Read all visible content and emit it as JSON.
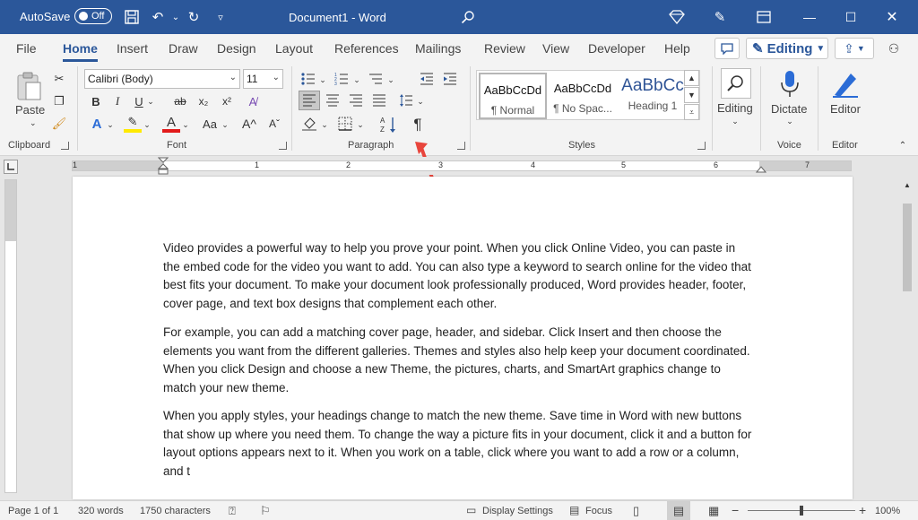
{
  "titlebar": {
    "autosave_label": "AutoSave",
    "autosave_state": "Off",
    "doc_title": "Document1  -  Word"
  },
  "tabs": [
    {
      "label": "File"
    },
    {
      "label": "Home"
    },
    {
      "label": "Insert"
    },
    {
      "label": "Draw"
    },
    {
      "label": "Design"
    },
    {
      "label": "Layout"
    },
    {
      "label": "References"
    },
    {
      "label": "Mailings"
    },
    {
      "label": "Review"
    },
    {
      "label": "View"
    },
    {
      "label": "Developer"
    },
    {
      "label": "Help"
    }
  ],
  "tabrow": {
    "editing_mode": "Editing"
  },
  "ribbon": {
    "clipboard": {
      "paste_label": "Paste",
      "group_label": "Clipboard"
    },
    "font": {
      "font_name": "Calibri (Body)",
      "font_size": "11",
      "group_label": "Font"
    },
    "paragraph": {
      "group_label": "Paragraph"
    },
    "styles": {
      "group_label": "Styles",
      "tiles": [
        {
          "preview": "AaBbCcDd",
          "name": "¶ Normal"
        },
        {
          "preview": "AaBbCcDd",
          "name": "¶ No Spac..."
        },
        {
          "preview": "AaBbCc",
          "name": "Heading 1"
        }
      ]
    },
    "editing": {
      "label": "Editing"
    },
    "voice": {
      "label": "Dictate",
      "group_label": "Voice"
    },
    "editor": {
      "label": "Editor",
      "group_label": "Editor"
    }
  },
  "ruler": {
    "numbers": [
      "1",
      "1",
      "2",
      "3",
      "4",
      "5",
      "6",
      "7"
    ]
  },
  "document": {
    "paragraphs": [
      "Video provides a powerful way to help you prove your point. When you click Online Video, you can paste in the embed code for the video you want to add. You can also type a keyword to search online for the video that best fits your document. To make your document look professionally produced, Word provides header, footer, cover page, and text box designs that complement each other.",
      "For example, you can add a matching cover page, header, and sidebar. Click Insert and then choose the elements you want from the different galleries. Themes and styles also help keep your document coordinated. When you click Design and choose a new Theme, the pictures, charts, and SmartArt graphics change to match your new theme.",
      "When you apply styles, your headings change to match the new theme. Save time in Word with new buttons that show up where you need them. To change the way a picture fits in your document, click it and a button for layout options appears next to it. When you work on a table, click where you want to add a row or a column, and t"
    ]
  },
  "statusbar": {
    "page": "Page 1 of 1",
    "words": "320 words",
    "characters": "1750 characters",
    "display_settings": "Display Settings",
    "focus": "Focus",
    "zoom": "100%"
  },
  "colors": {
    "word_blue": "#2b579a",
    "annotation_red": "#e8453c"
  }
}
